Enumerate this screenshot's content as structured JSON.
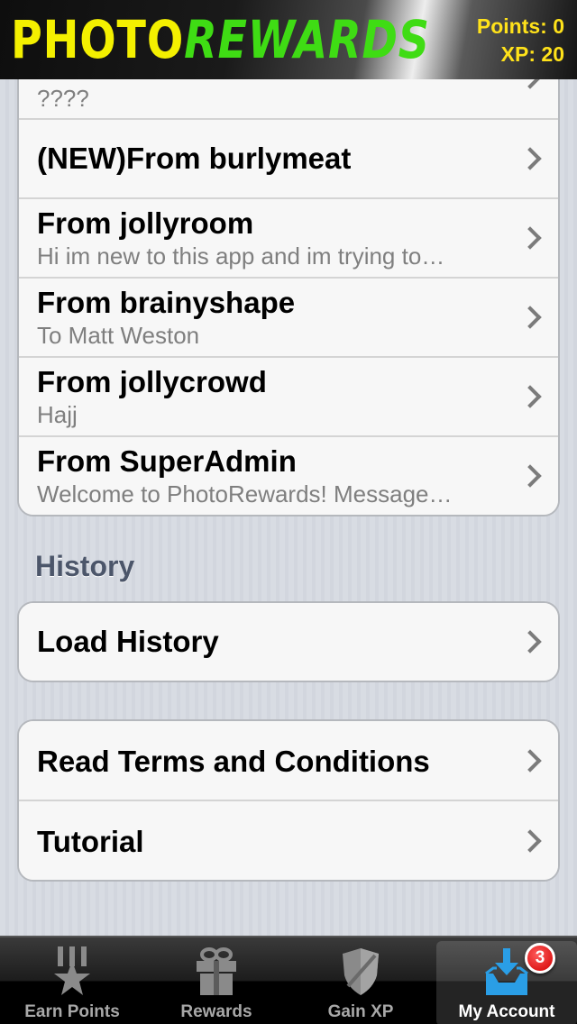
{
  "header": {
    "logo_part1": "PHOTO",
    "logo_part2": "REWARDS",
    "points": "Points: 0",
    "xp": "XP: 20"
  },
  "messages": [
    {
      "title": "",
      "subtitle": "????"
    },
    {
      "title": "(NEW)From burlymeat",
      "subtitle": ""
    },
    {
      "title": "From jollyroom",
      "subtitle": "Hi im new to this app and im trying to…"
    },
    {
      "title": "From brainyshape",
      "subtitle": "To Matt Weston"
    },
    {
      "title": "From jollycrowd",
      "subtitle": "Hajj"
    },
    {
      "title": "From SuperAdmin",
      "subtitle": "Welcome to PhotoRewards! Message…"
    }
  ],
  "history": {
    "section_title": "History",
    "load_label": "Load History"
  },
  "other": {
    "terms_label": "Read Terms and Conditions",
    "tutorial_label": "Tutorial"
  },
  "tabs": [
    {
      "label": "Earn Points",
      "icon": "medal-star-icon"
    },
    {
      "label": "Rewards",
      "icon": "gift-icon"
    },
    {
      "label": "Gain XP",
      "icon": "shield-icon"
    },
    {
      "label": "My Account",
      "icon": "inbox-download-icon",
      "badge": "3"
    }
  ],
  "colors": {
    "logo_yellow": "#f4f000",
    "logo_green": "#3fdc14",
    "stats_yellow": "#ffe21a",
    "active_icon_blue": "#2a9ee6",
    "badge_red": "#d10000"
  }
}
